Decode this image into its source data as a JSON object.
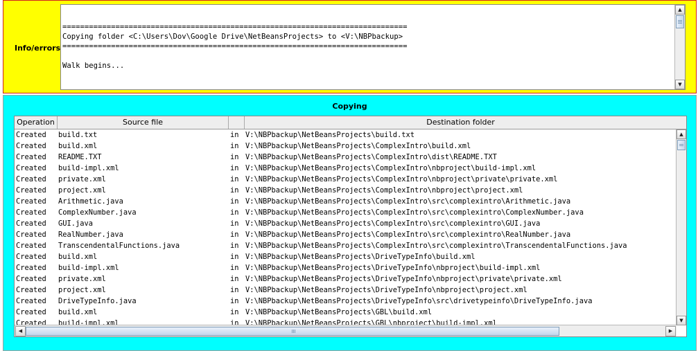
{
  "info": {
    "label": "Info/errors",
    "lines": [
      "==============================================================================",
      "Copying folder <C:\\Users\\Dov\\Google Drive\\NetBeansProjects> to <V:\\NBPbackup>",
      "==============================================================================",
      "",
      "Walk begins..."
    ]
  },
  "copying": {
    "title": "Copying",
    "columns": [
      "Operation",
      "Source file",
      "",
      "Destination folder"
    ],
    "rows": [
      [
        "Created",
        "build.txt",
        "in",
        "V:\\NBPbackup\\NetBeansProjects\\build.txt"
      ],
      [
        "Created",
        "build.xml",
        "in",
        "V:\\NBPbackup\\NetBeansProjects\\ComplexIntro\\build.xml"
      ],
      [
        "Created",
        "README.TXT",
        "in",
        "V:\\NBPbackup\\NetBeansProjects\\ComplexIntro\\dist\\README.TXT"
      ],
      [
        "Created",
        "build-impl.xml",
        "in",
        "V:\\NBPbackup\\NetBeansProjects\\ComplexIntro\\nbproject\\build-impl.xml"
      ],
      [
        "Created",
        "private.xml",
        "in",
        "V:\\NBPbackup\\NetBeansProjects\\ComplexIntro\\nbproject\\private\\private.xml"
      ],
      [
        "Created",
        "project.xml",
        "in",
        "V:\\NBPbackup\\NetBeansProjects\\ComplexIntro\\nbproject\\project.xml"
      ],
      [
        "Created",
        "Arithmetic.java",
        "in",
        "V:\\NBPbackup\\NetBeansProjects\\ComplexIntro\\src\\complexintro\\Arithmetic.java"
      ],
      [
        "Created",
        "ComplexNumber.java",
        "in",
        "V:\\NBPbackup\\NetBeansProjects\\ComplexIntro\\src\\complexintro\\ComplexNumber.java"
      ],
      [
        "Created",
        "GUI.java",
        "in",
        "V:\\NBPbackup\\NetBeansProjects\\ComplexIntro\\src\\complexintro\\GUI.java"
      ],
      [
        "Created",
        "RealNumber.java",
        "in",
        "V:\\NBPbackup\\NetBeansProjects\\ComplexIntro\\src\\complexintro\\RealNumber.java"
      ],
      [
        "Created",
        "TranscendentalFunctions.java",
        "in",
        "V:\\NBPbackup\\NetBeansProjects\\ComplexIntro\\src\\complexintro\\TranscendentalFunctions.java"
      ],
      [
        "Created",
        "build.xml",
        "in",
        "V:\\NBPbackup\\NetBeansProjects\\DriveTypeInfo\\build.xml"
      ],
      [
        "Created",
        "build-impl.xml",
        "in",
        "V:\\NBPbackup\\NetBeansProjects\\DriveTypeInfo\\nbproject\\build-impl.xml"
      ],
      [
        "Created",
        "private.xml",
        "in",
        "V:\\NBPbackup\\NetBeansProjects\\DriveTypeInfo\\nbproject\\private\\private.xml"
      ],
      [
        "Created",
        "project.xml",
        "in",
        "V:\\NBPbackup\\NetBeansProjects\\DriveTypeInfo\\nbproject\\project.xml"
      ],
      [
        "Created",
        "DriveTypeInfo.java",
        "in",
        "V:\\NBPbackup\\NetBeansProjects\\DriveTypeInfo\\src\\drivetypeinfo\\DriveTypeInfo.java"
      ],
      [
        "Created",
        "build.xml",
        "in",
        "V:\\NBPbackup\\NetBeansProjects\\GBL\\build.xml"
      ],
      [
        "Created",
        "build-impl.xml",
        "in",
        "V:\\NBPbackup\\NetBeansProjects\\GBL\\nbproject\\build-impl.xml"
      ]
    ]
  },
  "icons": {
    "scroll_up": "▲",
    "scroll_down": "▼",
    "scroll_left": "◀",
    "scroll_right": "▶"
  },
  "colors": {
    "info_panel_bg": "#ffff00",
    "copying_panel_bg": "#00ffff"
  }
}
